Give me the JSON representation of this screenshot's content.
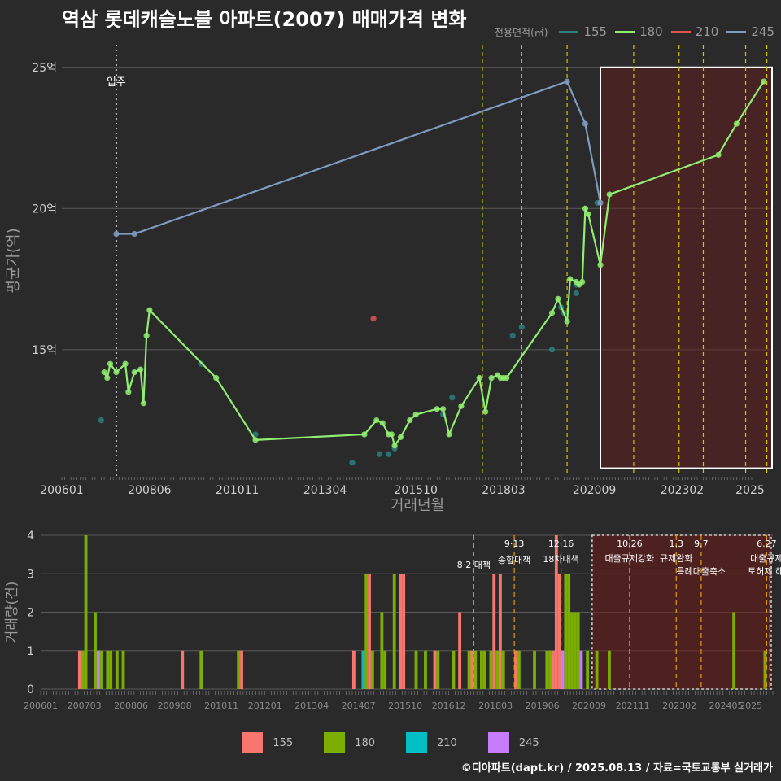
{
  "title": "역삼 롯데캐슬노블 아파트(2007) 매매가격 변화",
  "legend_title": "전용면적(㎡)",
  "series_colors": {
    "155": "#2a7f7f",
    "180": "#90ee70",
    "210": "#e05050",
    "245": "#7f9cc0"
  },
  "bar_colors": {
    "155": "#f8766d",
    "180": "#7cae00",
    "210": "#00bfc4",
    "245": "#c77cff"
  },
  "credit": "©디아파트(dapt.kr) / 2025.08.13 / 자료=국토교통부 실거래가",
  "chart_data": [
    {
      "type": "line",
      "xlabel": "거래년월",
      "ylabel": "평균가(억)",
      "ylim": [
        10.5,
        25.8
      ],
      "xlim": [
        "2006-01",
        "2025-08"
      ],
      "y_ticks": [
        {
          "v": 15,
          "label": "15억"
        },
        {
          "v": 20,
          "label": "20억"
        },
        {
          "v": 25,
          "label": "25억"
        }
      ],
      "x_ticks": [
        "200601",
        "200806",
        "201011",
        "201304",
        "201510",
        "201803",
        "202009",
        "202302",
        "2025"
      ],
      "annotation": "입주",
      "annotation_x": "2007-07",
      "highlight_range": [
        "2020-11",
        "2025-08"
      ],
      "policy_lines": [
        "2017-08",
        "2018-09",
        "2019-12",
        "2021-10",
        "2023-01",
        "2023-09",
        "2024-11",
        "2025-06"
      ],
      "series": [
        {
          "name": "155",
          "points": [
            [
              "2007-02",
              12.5
            ],
            [
              "2009-11",
              14.5
            ],
            [
              "2011-05",
              12.0
            ],
            [
              "2014-01",
              11.0
            ],
            [
              "2014-05",
              12.0
            ],
            [
              "2014-10",
              11.3
            ],
            [
              "2015-01",
              11.3
            ],
            [
              "2015-03",
              11.5
            ],
            [
              "2016-07",
              12.7
            ],
            [
              "2016-10",
              13.3
            ],
            [
              "2018-06",
              15.5
            ],
            [
              "2018-09",
              15.8
            ],
            [
              "2019-07",
              15.0
            ],
            [
              "2019-10",
              16.5
            ],
            [
              "2019-11",
              16.3
            ],
            [
              "2020-03",
              17.0
            ],
            [
              "2020-03",
              17.3
            ],
            [
              "2020-10",
              20.2
            ]
          ]
        },
        {
          "name": "180",
          "line": true,
          "points": [
            [
              "2007-03",
              14.2
            ],
            [
              "2007-04",
              14.0
            ],
            [
              "2007-05",
              14.5
            ],
            [
              "2007-07",
              14.2
            ],
            [
              "2007-10",
              14.5
            ],
            [
              "2007-11",
              13.5
            ],
            [
              "2008-01",
              14.2
            ],
            [
              "2008-03",
              14.3
            ],
            [
              "2008-04",
              13.1
            ],
            [
              "2008-05",
              15.5
            ],
            [
              "2008-06",
              16.4
            ],
            [
              "2010-04",
              14.0
            ],
            [
              "2011-05",
              11.8
            ],
            [
              "2014-05",
              12.0
            ],
            [
              "2014-09",
              12.5
            ],
            [
              "2014-11",
              12.4
            ],
            [
              "2015-01",
              12.0
            ],
            [
              "2015-02",
              12.0
            ],
            [
              "2015-03",
              11.6
            ],
            [
              "2015-05",
              11.9
            ],
            [
              "2015-08",
              12.5
            ],
            [
              "2015-10",
              12.7
            ],
            [
              "2016-05",
              12.9
            ],
            [
              "2016-07",
              12.9
            ],
            [
              "2016-09",
              12.0
            ],
            [
              "2017-01",
              13.0
            ],
            [
              "2017-07",
              14.0
            ],
            [
              "2017-09",
              12.8
            ],
            [
              "2017-11",
              14.0
            ],
            [
              "2018-01",
              14.1
            ],
            [
              "2018-02",
              14.0
            ],
            [
              "2018-03",
              14.0
            ],
            [
              "2018-04",
              14.0
            ],
            [
              "2019-07",
              16.3
            ],
            [
              "2019-09",
              16.8
            ],
            [
              "2019-12",
              16.0
            ],
            [
              "2020-01",
              17.5
            ],
            [
              "2020-03",
              17.4
            ],
            [
              "2020-04",
              17.3
            ],
            [
              "2020-05",
              17.4
            ],
            [
              "2020-06",
              20.0
            ],
            [
              "2020-07",
              19.8
            ],
            [
              "2020-11",
              18.0
            ],
            [
              "2021-02",
              20.5
            ],
            [
              "2024-02",
              21.9
            ],
            [
              "2024-08",
              23.0
            ],
            [
              "2025-05",
              24.5
            ]
          ]
        },
        {
          "name": "210",
          "points": [
            [
              "2014-08",
              16.1
            ]
          ]
        },
        {
          "name": "245",
          "line": true,
          "points": [
            [
              "2007-07",
              19.1
            ],
            [
              "2008-01",
              19.1
            ],
            [
              "2019-12",
              24.5
            ],
            [
              "2020-06",
              23.0
            ],
            [
              "2020-11",
              20.2
            ]
          ]
        }
      ]
    },
    {
      "type": "bar",
      "xlabel": "",
      "ylabel": "거래량(건)",
      "ylim": [
        0,
        4
      ],
      "y_ticks": [
        0,
        1,
        2,
        3,
        4
      ],
      "x_ticks": [
        "200601",
        "200703",
        "200806",
        "200908",
        "201011",
        "201201",
        "201304",
        "201407",
        "201510",
        "201612",
        "201803",
        "201906",
        "202009",
        "202111",
        "202302",
        "202405",
        "2025"
      ],
      "highlight_range": [
        "2020-10",
        "2025-08"
      ],
      "policy_events": [
        {
          "date": "2017-08",
          "label": "8·2 대책",
          "top": ""
        },
        {
          "date": "2018-09",
          "label": "종합대책",
          "top": "9·13"
        },
        {
          "date": "2019-12",
          "label": "18차대책",
          "top": "12·16"
        },
        {
          "date": "2021-10",
          "label": "대출규제강화",
          "top": "10.26"
        },
        {
          "date": "2023-01",
          "label": "규제완화",
          "top": "1.3"
        },
        {
          "date": "2023-09",
          "label": "특례대출축소",
          "top": "9.7"
        },
        {
          "date": "2025-06",
          "label": "대출규제",
          "top": "6.27"
        },
        {
          "date": "2025-07",
          "label": "토허제 해제",
          "top": ""
        }
      ],
      "series": [
        {
          "name": "155",
          "values": [
            [
              "2007-01",
              1
            ],
            [
              "2009-10",
              1
            ],
            [
              "2011-05",
              1
            ],
            [
              "2014-05",
              1
            ],
            [
              "2014-08",
              1
            ],
            [
              "2014-10",
              3
            ],
            [
              "2015-08",
              3
            ],
            [
              "2015-09",
              3
            ],
            [
              "2016-07",
              1
            ],
            [
              "2017-03",
              2
            ],
            [
              "2017-07",
              1
            ],
            [
              "2018-02",
              3
            ],
            [
              "2018-04",
              3
            ],
            [
              "2018-09",
              1
            ],
            [
              "2019-09",
              1
            ],
            [
              "2019-10",
              4
            ],
            [
              "2019-11",
              3
            ]
          ]
        },
        {
          "name": "180",
          "values": [
            [
              "2007-02",
              1
            ],
            [
              "2007-03",
              4
            ],
            [
              "2007-06",
              2
            ],
            [
              "2007-07",
              1
            ],
            [
              "2007-08",
              1
            ],
            [
              "2007-10",
              1
            ],
            [
              "2007-11",
              1
            ],
            [
              "2008-01",
              1
            ],
            [
              "2008-03",
              1
            ],
            [
              "2010-04",
              1
            ],
            [
              "2011-04",
              1
            ],
            [
              "2014-09",
              3
            ],
            [
              "2014-11",
              1
            ],
            [
              "2015-02",
              2
            ],
            [
              "2015-03",
              1
            ],
            [
              "2015-06",
              3
            ],
            [
              "2016-01",
              1
            ],
            [
              "2016-04",
              1
            ],
            [
              "2016-08",
              1
            ],
            [
              "2017-01",
              1
            ],
            [
              "2017-06",
              1
            ],
            [
              "2017-08",
              1
            ],
            [
              "2017-10",
              1
            ],
            [
              "2017-11",
              1
            ],
            [
              "2018-01",
              1
            ],
            [
              "2018-03",
              1
            ],
            [
              "2018-05",
              1
            ],
            [
              "2018-10",
              1
            ],
            [
              "2019-03",
              1
            ],
            [
              "2019-07",
              1
            ],
            [
              "2019-08",
              1
            ],
            [
              "2020-01",
              3
            ],
            [
              "2020-02",
              3
            ],
            [
              "2020-03",
              2
            ],
            [
              "2020-04",
              2
            ],
            [
              "2020-05",
              2
            ],
            [
              "2020-08",
              1
            ],
            [
              "2020-11",
              1
            ],
            [
              "2021-03",
              1
            ],
            [
              "2024-07",
              2
            ],
            [
              "2025-05",
              1
            ]
          ]
        },
        {
          "name": "210",
          "values": [
            [
              "2014-08",
              1
            ]
          ]
        },
        {
          "name": "245",
          "values": [
            [
              "2007-07",
              1
            ],
            [
              "2019-12",
              1
            ],
            [
              "2020-06",
              1
            ]
          ]
        }
      ]
    }
  ]
}
